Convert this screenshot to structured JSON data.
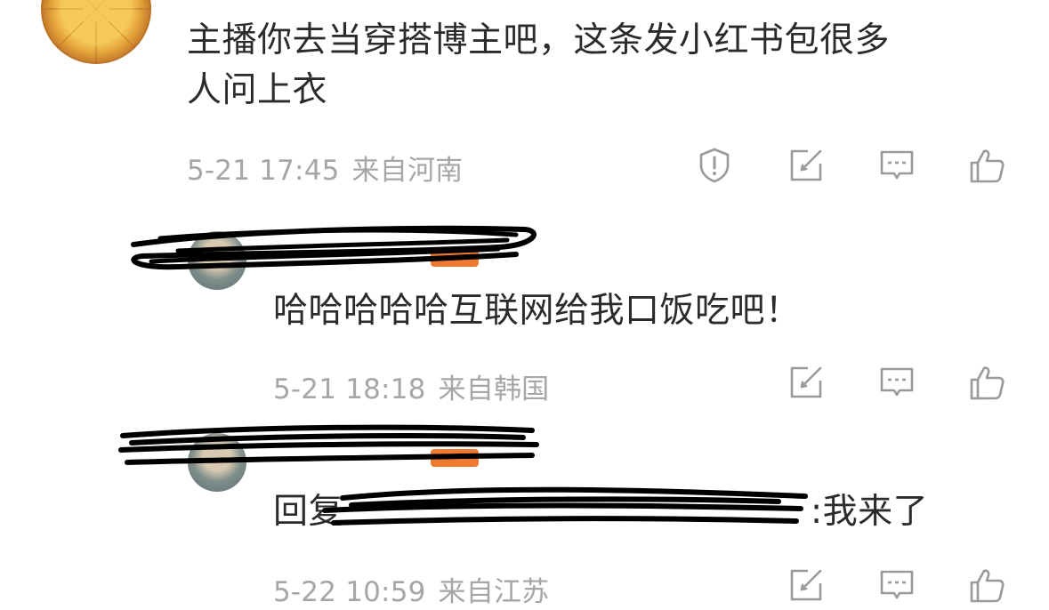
{
  "comments": [
    {
      "text": "主播你去当穿搭博主吧，这条发小红书包很多人问上衣",
      "text_line1": "主播你去当穿搭博主吧，这条发小红书包很多",
      "text_line2": "人问上衣",
      "time": "5-21 17:45",
      "location": "来自河南",
      "actions": [
        "report-icon",
        "share-icon",
        "comment-icon",
        "like-icon"
      ]
    }
  ],
  "replies": [
    {
      "text": "哈哈哈哈哈互联网给我口饭吃吧！",
      "time": "5-21 18:18",
      "location": "来自韩国",
      "actions": [
        "share-icon",
        "comment-icon",
        "like-icon"
      ]
    },
    {
      "reply_prefix": "回复",
      "reply_suffix": ":我来了",
      "time": "5-22 10:59",
      "location": "来自江苏",
      "actions": [
        "share-icon",
        "comment-icon",
        "like-icon"
      ]
    }
  ],
  "colors": {
    "text": "#2b2b2b",
    "meta": "#a6a6a6",
    "icon": "#9a9a9a",
    "mention": "#4a6fb0",
    "badge": "#f07a2f"
  }
}
